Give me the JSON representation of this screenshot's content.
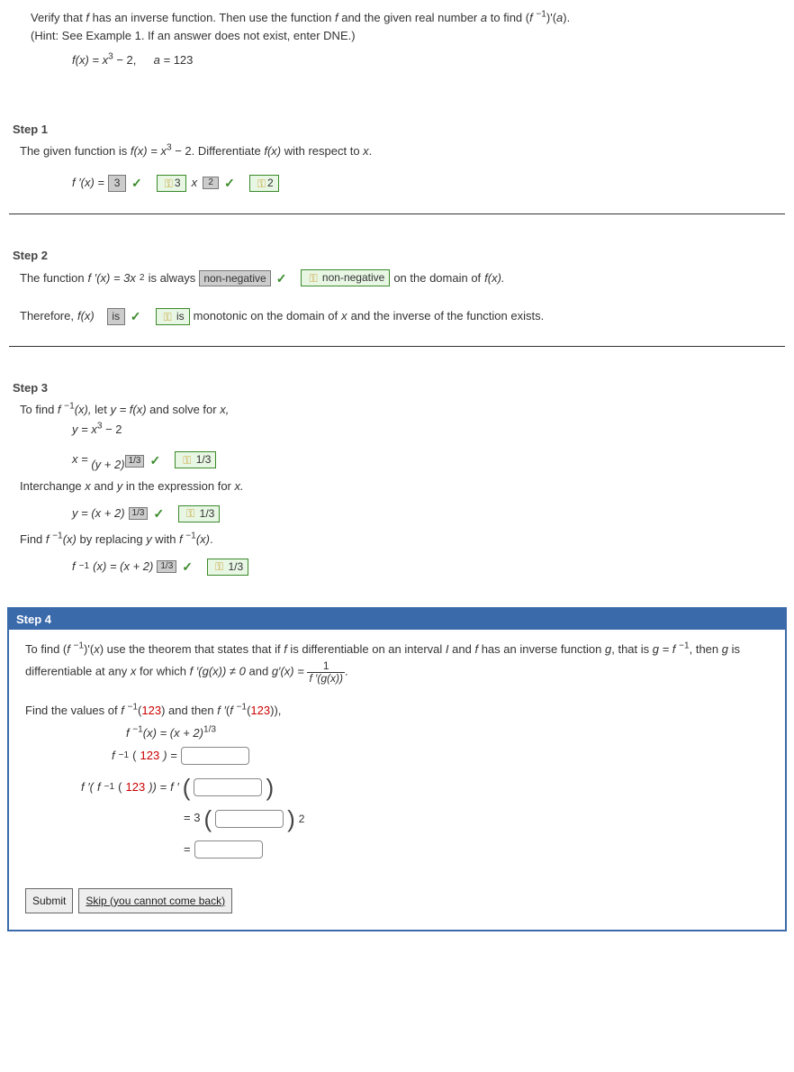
{
  "intro": {
    "line1a": "Verify that ",
    "line1b": " has an inverse function. Then use the function ",
    "line1c": " and the given real number ",
    "line1d": " to find  (",
    "line1e": ")'(",
    "line1f": ").",
    "hint": "(Hint: See Example 1. If an answer does not exist, enter DNE.)",
    "fx_eq": "f(x) = x",
    "fx_cube": "3",
    "fx_tail": " − 2,",
    "a_eq": "a = ",
    "a_val": "123"
  },
  "step1": {
    "title": "Step 1",
    "leadA": "The given function is  ",
    "leadB": " − 2.  Differentiate  ",
    "leadC": "  with respect to ",
    "leadD": ".",
    "fx": "f(x) = x",
    "fx_pwr": "3",
    "fprime": "f ′(x)  =  ",
    "ans": "3",
    "green_coef": "3",
    "green_exp": "2",
    "x_sup": "2"
  },
  "step2": {
    "title": "Step 2",
    "leadA": "The function  ",
    "fprime": "f ′(x) = 3x",
    "pwr": "2",
    "leadB": "  is always ",
    "ans1": "non-negative",
    "green1": "non-negative",
    "leadC": " on the domain of ",
    "fx": "f(x).",
    "thereforeA": "Therefore,  ",
    "fxw": "f(x)",
    "ans2": "is",
    "green2": "is",
    "thereforeB": " monotonic on the domain of ",
    "xw": "x",
    "thereforeC": " and the inverse of the function exists."
  },
  "step3": {
    "title": "Step 3",
    "leadA": "To find  ",
    "finv": "f ",
    "finv_exp": "−1",
    "finv_arg": "(x),",
    "leadB": "  let  ",
    "y_eq": "y = f(x)",
    "leadC": "  and solve for ",
    "xw": "x,",
    "eq1": "y  =  x",
    "eq1_pwr": "3",
    "eq1_tail": " − 2",
    "x_eq": "x  =",
    "base_yp2": "(y + 2)",
    "ans_13a": "1/3",
    "green_13a": "1/3",
    "inter": "Interchange ",
    "inter_x": "x",
    "inter_and": " and ",
    "inter_y": "y",
    "inter_tail": " in the expression for ",
    "inter_x2": "x.",
    "y_eq2": "y = (x + 2)",
    "ans_13b": "1/3",
    "green_13b": "1/3",
    "findA": "Find  ",
    "findB": "  by replacing ",
    "y_lone": "y",
    "findC": " with  ",
    "findD": ".",
    "finv_eq": "(x) = (x + 2)",
    "ans_13c": "1/3",
    "green_13c": "1/3"
  },
  "step4": {
    "title": "Step 4",
    "p1a": "To find  (",
    "p1b": ")'(",
    "p1c": ")  use the theorem that states that if ",
    "p1d": " is differentiable on an interval ",
    "p1e": " and ",
    "p1f": " has an inverse function ",
    "p1g": ", that is  ",
    "p1h": ",  then ",
    "p1i": " is differentiable at any ",
    "p1j": " for which  ",
    "fpg": "f ′(g(x)) ≠ 0",
    "p1k": "  and  ",
    "gpx": "g′(x) = ",
    "frac_num": "1",
    "frac_den": "f ′(g(x))",
    "p2a": "Find the values of  ",
    "p2b": "  and then  ",
    "p2c": ",",
    "aval": "123",
    "eq_finvx": "(x)  =  (x + 2)",
    "exp13": "1/3",
    "eq_finv123": "(",
    "eq_finv123b": ")  =",
    "eq_fpfinvA": "f ′(",
    "eq_fpfinvB": "(",
    "eq_fpfinvC": "))  =  ",
    "fprime_open": "f ′",
    "threeTimes": "=  3",
    "sq": "2",
    "eqFinal": "="
  },
  "buttons": {
    "submit": "Submit",
    "skip": "Skip (you cannot come back)"
  }
}
